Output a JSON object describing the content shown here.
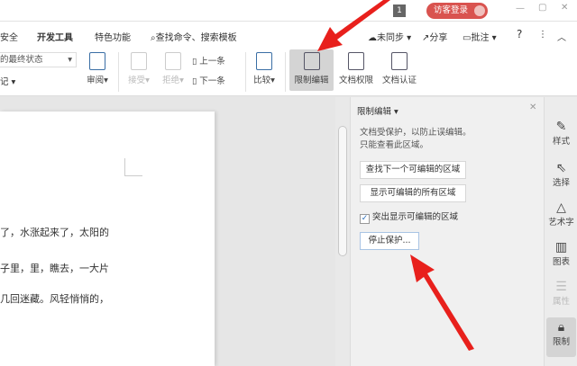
{
  "titlebar": {
    "page_badge": "1",
    "login_label": "访客登录",
    "login_color": "#d9534f"
  },
  "tabs": [
    {
      "label": "安全"
    },
    {
      "label": "开发工具"
    },
    {
      "label": "特色功能"
    }
  ],
  "search": {
    "placeholder": "查找命令、搜索模板"
  },
  "right_actions": {
    "sync": "未同步",
    "share": "分享",
    "comment": "批注",
    "help": "?"
  },
  "ribbon": {
    "display_select": "的最终状态",
    "markup": "记",
    "review": "审阅",
    "accept": "接受",
    "reject": "拒绝",
    "prev": "上一条",
    "next": "下一条",
    "compare": "比较",
    "restrict": "限制编辑",
    "permission": "文档权限",
    "certify": "文档认证"
  },
  "document": {
    "lines": [
      "了，水涨起来了，太阳的",
      "子里，里，瞧去，一大片",
      "几回迷藏。风轻悄悄的，"
    ]
  },
  "panel": {
    "title": "限制编辑",
    "desc1": "文档受保护，以防止误编辑。",
    "desc2": "只能查看此区域。",
    "find_next": "查找下一个可编辑的区域",
    "show_all": "显示可编辑的所有区域",
    "highlight": "突出显示可编辑的区域",
    "highlight_checked": true,
    "stop": "停止保护..."
  },
  "sidebar": [
    {
      "label": "样式",
      "icon": "pen-icon"
    },
    {
      "label": "选择",
      "icon": "cursor-icon"
    },
    {
      "label": "艺术字",
      "icon": "art-text-icon"
    },
    {
      "label": "图表",
      "icon": "chart-icon"
    },
    {
      "label": "属性",
      "icon": "properties-icon"
    },
    {
      "label": "限制",
      "icon": "lock-icon"
    }
  ]
}
